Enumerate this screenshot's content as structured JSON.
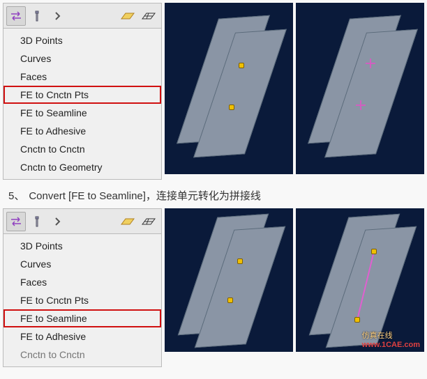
{
  "menu": {
    "items": [
      "3D Points",
      "Curves",
      "Faces",
      "FE to Cnctn Pts",
      "FE to Seamline",
      "FE to Adhesive",
      "Cnctn to Cnctn",
      "Cnctn to Geometry"
    ]
  },
  "step": {
    "num": "5、",
    "cmd": "Convert [FE to Seamline]，",
    "desc": "连接单元转化为拼接线"
  },
  "watermark": {
    "line1": "仿真在线",
    "line2": "www.1CAE.com"
  }
}
